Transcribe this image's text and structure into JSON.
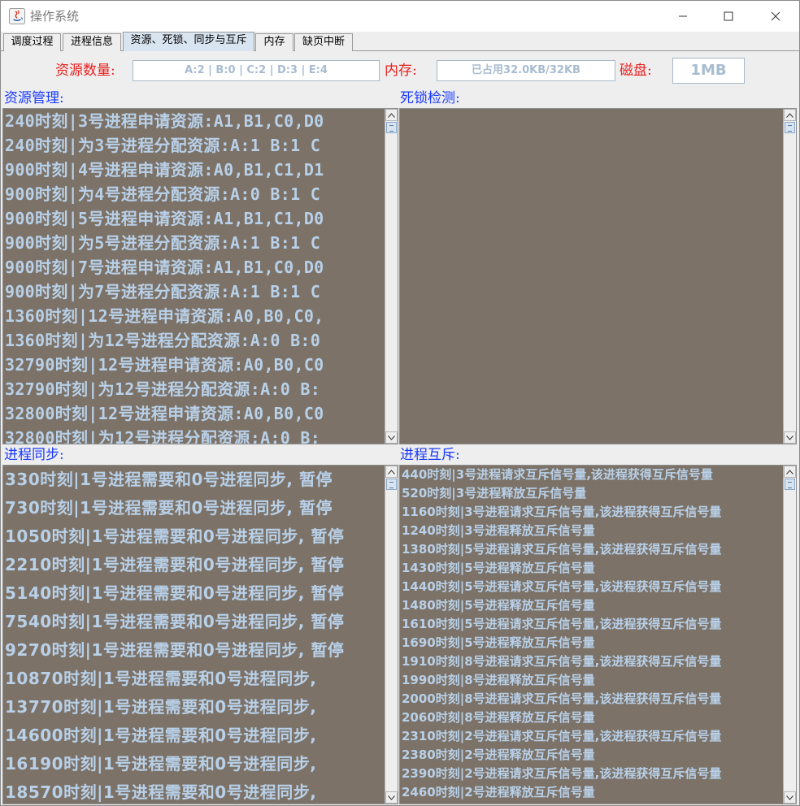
{
  "window": {
    "title": "操作系统"
  },
  "tabs": [
    {
      "label": "调度过程"
    },
    {
      "label": "进程信息"
    },
    {
      "label": "资源、死锁、同步与互斥",
      "active": true
    },
    {
      "label": "内存"
    },
    {
      "label": "缺页中断"
    }
  ],
  "status": {
    "resource_label": "资源数量:",
    "resource_value": "A:2 | B:0 | C:2 | D:3 | E:4",
    "memory_label": "内存:",
    "memory_value": "已占用32.0KB/32KB",
    "disk_label": "磁盘:",
    "disk_value": "1MB"
  },
  "resource_mgmt": {
    "label": "资源管理:",
    "lines": [
      "240时刻|3号进程申请资源:A1,B1,C0,D0",
      "240时刻|为3号进程分配资源:A:1 B:1 C",
      "900时刻|4号进程申请资源:A0,B1,C1,D1",
      "900时刻|为4号进程分配资源:A:0 B:1 C",
      "900时刻|5号进程申请资源:A1,B1,C1,D0",
      "900时刻|为5号进程分配资源:A:1 B:1 C",
      "900时刻|7号进程申请资源:A1,B1,C0,D0",
      "900时刻|为7号进程分配资源:A:1 B:1 C",
      "1360时刻|12号进程申请资源:A0,B0,C0,",
      "1360时刻|为12号进程分配资源:A:0 B:0",
      "32790时刻|12号进程申请资源:A0,B0,C0",
      "32790时刻|为12号进程分配资源:A:0 B:",
      "32800时刻|12号进程申请资源:A0,B0,C0",
      "32800时刻|为12号进程分配资源:A:0 B:"
    ]
  },
  "deadlock": {
    "label": "死锁检测:",
    "lines": []
  },
  "sync": {
    "label": "进程同步:",
    "lines": [
      "330时刻|1号进程需要和0号进程同步, 暂停",
      "730时刻|1号进程需要和0号进程同步, 暂停",
      "1050时刻|1号进程需要和0号进程同步, 暂停",
      "2210时刻|1号进程需要和0号进程同步, 暂停",
      "5140时刻|1号进程需要和0号进程同步, 暂停",
      "7540时刻|1号进程需要和0号进程同步, 暂停",
      "9270时刻|1号进程需要和0号进程同步, 暂停",
      "10870时刻|1号进程需要和0号进程同步,",
      "13770时刻|1号进程需要和0号进程同步,",
      "14600时刻|1号进程需要和0号进程同步,",
      "16190时刻|1号进程需要和0号进程同步,",
      "18570时刻|1号进程需要和0号进程同步,"
    ]
  },
  "mutex": {
    "label": "进程互斥:",
    "lines": [
      "440时刻|3号进程请求互斥信号量,该进程获得互斥信号量",
      "520时刻|3号进程释放互斥信号量",
      "1160时刻|3号进程请求互斥信号量,该进程获得互斥信号量",
      "1240时刻|3号进程释放互斥信号量",
      "1380时刻|5号进程请求互斥信号量,该进程获得互斥信号量",
      "1430时刻|5号进程释放互斥信号量",
      "1440时刻|5号进程请求互斥信号量,该进程获得互斥信号量",
      "1480时刻|5号进程释放互斥信号量",
      "1610时刻|5号进程请求互斥信号量,该进程获得互斥信号量",
      "1690时刻|5号进程释放互斥信号量",
      "1910时刻|8号进程请求互斥信号量,该进程获得互斥信号量",
      "1990时刻|8号进程释放互斥信号量",
      "2000时刻|8号进程请求互斥信号量,该进程获得互斥信号量",
      "2060时刻|8号进程释放互斥信号量",
      "2310时刻|2号进程请求互斥信号量,该进程获得互斥信号量",
      "2380时刻|2号进程释放互斥信号量",
      "2390时刻|2号进程请求互斥信号量,该进程获得互斥信号量",
      "2460时刻|2号进程释放互斥信号量"
    ]
  }
}
